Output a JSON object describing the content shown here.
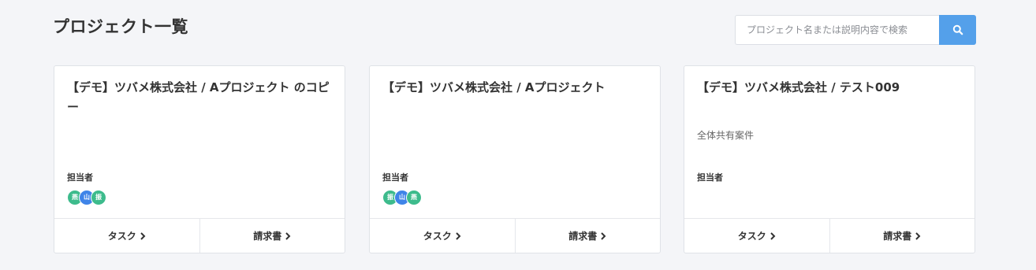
{
  "header": {
    "title": "プロジェクト一覧",
    "search_placeholder": "プロジェクト名または説明内容で検索",
    "search_icon": "search-icon"
  },
  "colors": {
    "accent": "#54a0ea",
    "avatar_green": "#3dbb8c",
    "avatar_blue": "#3f84e8"
  },
  "projects": [
    {
      "title": "【デモ】ツバメ株式会社 / Aプロジェクト のコピー",
      "description": "",
      "assignee_label": "担当者",
      "assignees": [
        "燕",
        "山",
        "振"
      ],
      "task_label": "タスク",
      "invoice_label": "請求書"
    },
    {
      "title": "【デモ】ツバメ株式会社 / Aプロジェクト",
      "description": "",
      "assignee_label": "担当者",
      "assignees": [
        "振",
        "山",
        "燕"
      ],
      "task_label": "タスク",
      "invoice_label": "請求書"
    },
    {
      "title": "【デモ】ツバメ株式会社 / テスト009",
      "description": "全体共有案件",
      "assignee_label": "担当者",
      "assignees": [],
      "task_label": "タスク",
      "invoice_label": "請求書"
    }
  ]
}
